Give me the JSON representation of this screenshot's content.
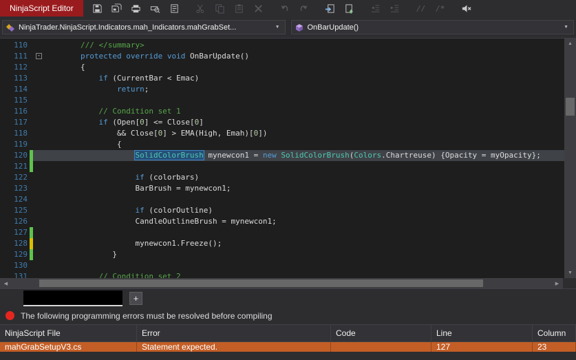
{
  "window": {
    "title": "NinjaScript Editor"
  },
  "toolbar": {
    "icons": [
      {
        "name": "save-icon",
        "enabled": true
      },
      {
        "name": "save-all-icon",
        "enabled": true
      },
      {
        "name": "print-icon",
        "enabled": true
      },
      {
        "name": "print-preview-icon",
        "enabled": true
      },
      {
        "name": "template-icon",
        "enabled": true
      },
      {
        "name": "cut-icon",
        "enabled": false
      },
      {
        "name": "copy-icon",
        "enabled": false
      },
      {
        "name": "paste-icon",
        "enabled": false
      },
      {
        "name": "delete-icon",
        "enabled": false
      },
      {
        "name": "undo-icon",
        "enabled": false
      },
      {
        "name": "redo-icon",
        "enabled": false
      },
      {
        "name": "goto-definition-icon",
        "enabled": true
      },
      {
        "name": "compile-icon",
        "enabled": true
      },
      {
        "name": "outdent-icon",
        "enabled": false
      },
      {
        "name": "indent-icon",
        "enabled": false
      },
      {
        "name": "comment-icon",
        "enabled": false
      },
      {
        "name": "uncomment-icon",
        "enabled": false
      },
      {
        "name": "mute-icon",
        "enabled": true
      }
    ]
  },
  "navbar": {
    "type_dropdown": {
      "value": "NinjaTrader.NinjaScript.Indicators.mah_Indicators.mahGrabSet...",
      "icon": "indicator-class-icon"
    },
    "member_dropdown": {
      "value": "OnBarUpdate()",
      "icon": "method-icon"
    }
  },
  "editor": {
    "lines": [
      {
        "n": 110,
        "segments": [
          {
            "t": "        /// </summary>",
            "c": "c"
          }
        ]
      },
      {
        "n": 111,
        "fold": true,
        "segments": [
          {
            "t": "        ",
            "c": "p"
          },
          {
            "t": "protected",
            "c": "k"
          },
          {
            "t": " ",
            "c": "p"
          },
          {
            "t": "override",
            "c": "k"
          },
          {
            "t": " ",
            "c": "p"
          },
          {
            "t": "void",
            "c": "k"
          },
          {
            "t": " OnBarUpdate()",
            "c": "p"
          }
        ]
      },
      {
        "n": 112,
        "segments": [
          {
            "t": "        {",
            "c": "p"
          }
        ]
      },
      {
        "n": 113,
        "segments": [
          {
            "t": "            ",
            "c": "p"
          },
          {
            "t": "if",
            "c": "k"
          },
          {
            "t": " (CurrentBar < Emac)",
            "c": "p"
          }
        ]
      },
      {
        "n": 114,
        "segments": [
          {
            "t": "                ",
            "c": "p"
          },
          {
            "t": "return",
            "c": "k"
          },
          {
            "t": ";",
            "c": "p"
          }
        ]
      },
      {
        "n": 115,
        "segments": []
      },
      {
        "n": 116,
        "segments": [
          {
            "t": "            // Condition set 1",
            "c": "c"
          }
        ]
      },
      {
        "n": 117,
        "segments": [
          {
            "t": "            ",
            "c": "p"
          },
          {
            "t": "if",
            "c": "k"
          },
          {
            "t": " (Open[",
            "c": "p"
          },
          {
            "t": "0",
            "c": "n"
          },
          {
            "t": "] <= Close[",
            "c": "p"
          },
          {
            "t": "0",
            "c": "n"
          },
          {
            "t": "]",
            "c": "p"
          }
        ]
      },
      {
        "n": 118,
        "segments": [
          {
            "t": "                && Close[",
            "c": "p"
          },
          {
            "t": "0",
            "c": "n"
          },
          {
            "t": "] > EMA(High, Emah)[",
            "c": "p"
          },
          {
            "t": "0",
            "c": "n"
          },
          {
            "t": "])",
            "c": "p"
          }
        ]
      },
      {
        "n": 119,
        "segments": [
          {
            "t": "                {",
            "c": "p"
          }
        ]
      },
      {
        "n": 120,
        "current": true,
        "marker": "green",
        "segments": [
          {
            "t": "                    ",
            "c": "p"
          },
          {
            "t": "SolidColorBrush",
            "c": "t",
            "sel": true
          },
          {
            "t": " mynewcon1 = ",
            "c": "p"
          },
          {
            "t": "new",
            "c": "k"
          },
          {
            "t": " ",
            "c": "p"
          },
          {
            "t": "SolidColorBrush",
            "c": "t"
          },
          {
            "t": "(",
            "c": "p"
          },
          {
            "t": "Colors",
            "c": "t"
          },
          {
            "t": ".Chartreuse) {Opacity = myOpacity};",
            "c": "p"
          }
        ]
      },
      {
        "n": 121,
        "marker": "green",
        "segments": []
      },
      {
        "n": 122,
        "segments": [
          {
            "t": "                    ",
            "c": "p"
          },
          {
            "t": "if",
            "c": "k"
          },
          {
            "t": " (colorbars)",
            "c": "p"
          }
        ]
      },
      {
        "n": 123,
        "segments": [
          {
            "t": "                    BarBrush = mynewcon1;",
            "c": "p"
          }
        ]
      },
      {
        "n": 124,
        "segments": []
      },
      {
        "n": 125,
        "segments": [
          {
            "t": "                    ",
            "c": "p"
          },
          {
            "t": "if",
            "c": "k"
          },
          {
            "t": " (colorOutline)",
            "c": "p"
          }
        ]
      },
      {
        "n": 126,
        "segments": [
          {
            "t": "                    CandleOutlineBrush = mynewcon1;",
            "c": "p"
          }
        ]
      },
      {
        "n": 127,
        "marker": "green",
        "segments": []
      },
      {
        "n": 128,
        "marker": "yellow",
        "segments": [
          {
            "t": "                    mynewcon1.Freeze();",
            "c": "p"
          }
        ]
      },
      {
        "n": 129,
        "marker": "green",
        "segments": [
          {
            "t": "               }",
            "c": "p"
          }
        ]
      },
      {
        "n": 130,
        "segments": []
      },
      {
        "n": 131,
        "segments": [
          {
            "t": "            // Condition set 2",
            "c": "c"
          }
        ]
      }
    ]
  },
  "tab_bar": {
    "add_button_label": "+"
  },
  "error_banner": {
    "text": "The following programming errors must be resolved before compiling"
  },
  "errors_table": {
    "columns": [
      "NinjaScript File",
      "Error",
      "Code",
      "Line",
      "Column"
    ],
    "rows": [
      {
        "file": "mahGrabSetupV3.cs",
        "error": "Statement expected.",
        "code": "",
        "line": "127",
        "column": "23",
        "selected": true
      }
    ]
  },
  "colors": {
    "title_red": "#9a1b1e",
    "selected_row_orange": "#c35e26",
    "error_red": "#e5261f",
    "keyword_blue": "#569cd6",
    "type_teal": "#4ec9b0",
    "comment_green": "#57a64a",
    "number_green": "#b5cea8",
    "line_number_blue": "#3f7cae",
    "change_marker_green": "#5fc24d",
    "change_marker_yellow": "#d8c000"
  }
}
